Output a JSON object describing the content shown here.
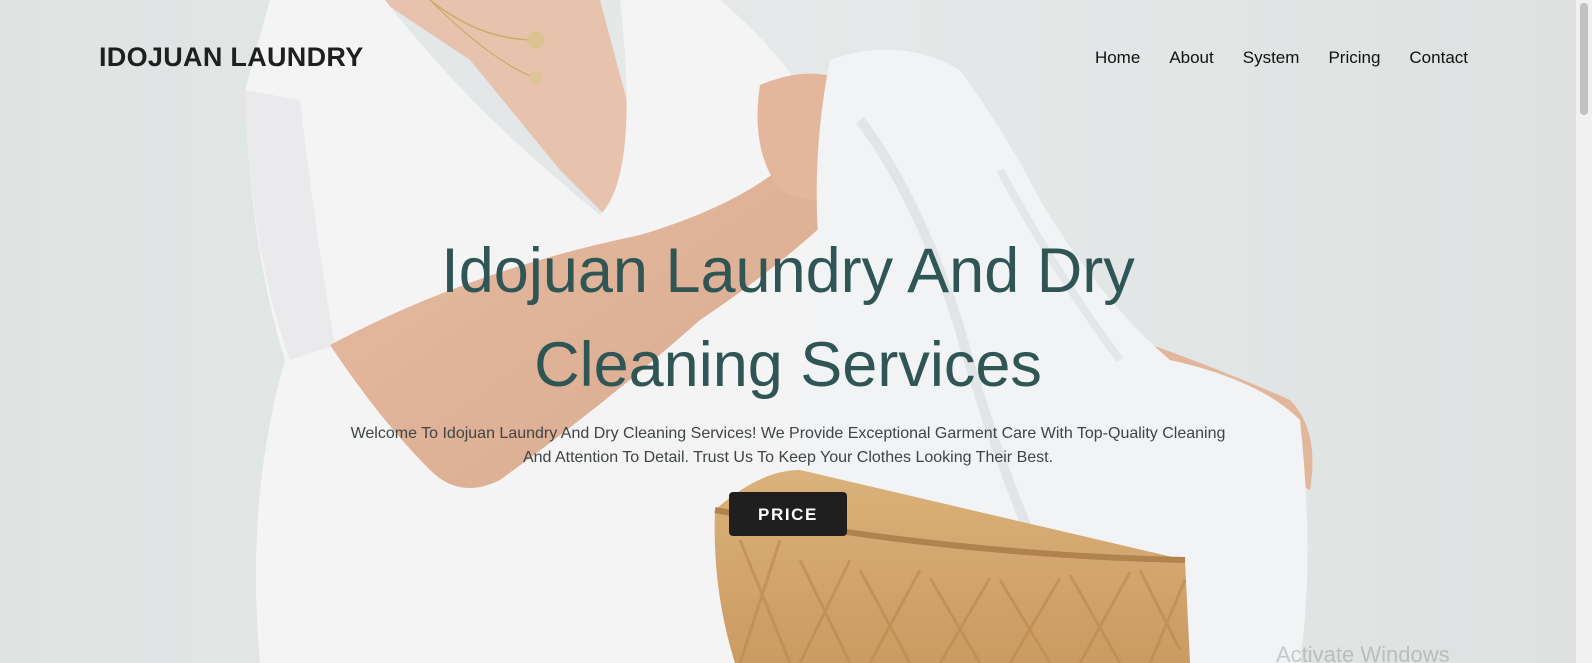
{
  "brand": {
    "name": "IDOJUAN LAUNDRY"
  },
  "nav": {
    "items": [
      {
        "label": "Home"
      },
      {
        "label": "About"
      },
      {
        "label": "System"
      },
      {
        "label": "Pricing"
      },
      {
        "label": "Contact"
      }
    ]
  },
  "hero": {
    "title": "Idojuan Laundry And Dry Cleaning Services",
    "subtitle": "Welcome To Idojuan Laundry And Dry Cleaning Services! We Provide Exceptional Garment Care With Top-Quality Cleaning And Attention To Detail. Trust Us To Keep Your Clothes Looking Their Best.",
    "cta_label": "PRICE",
    "image_icon": "woman-holding-laundry-basket-photo"
  },
  "watermark": {
    "text": "Activate Windows"
  },
  "colors": {
    "title": "#2f5554",
    "button_bg": "#1f1f1f",
    "background": "#e2e6e5"
  }
}
